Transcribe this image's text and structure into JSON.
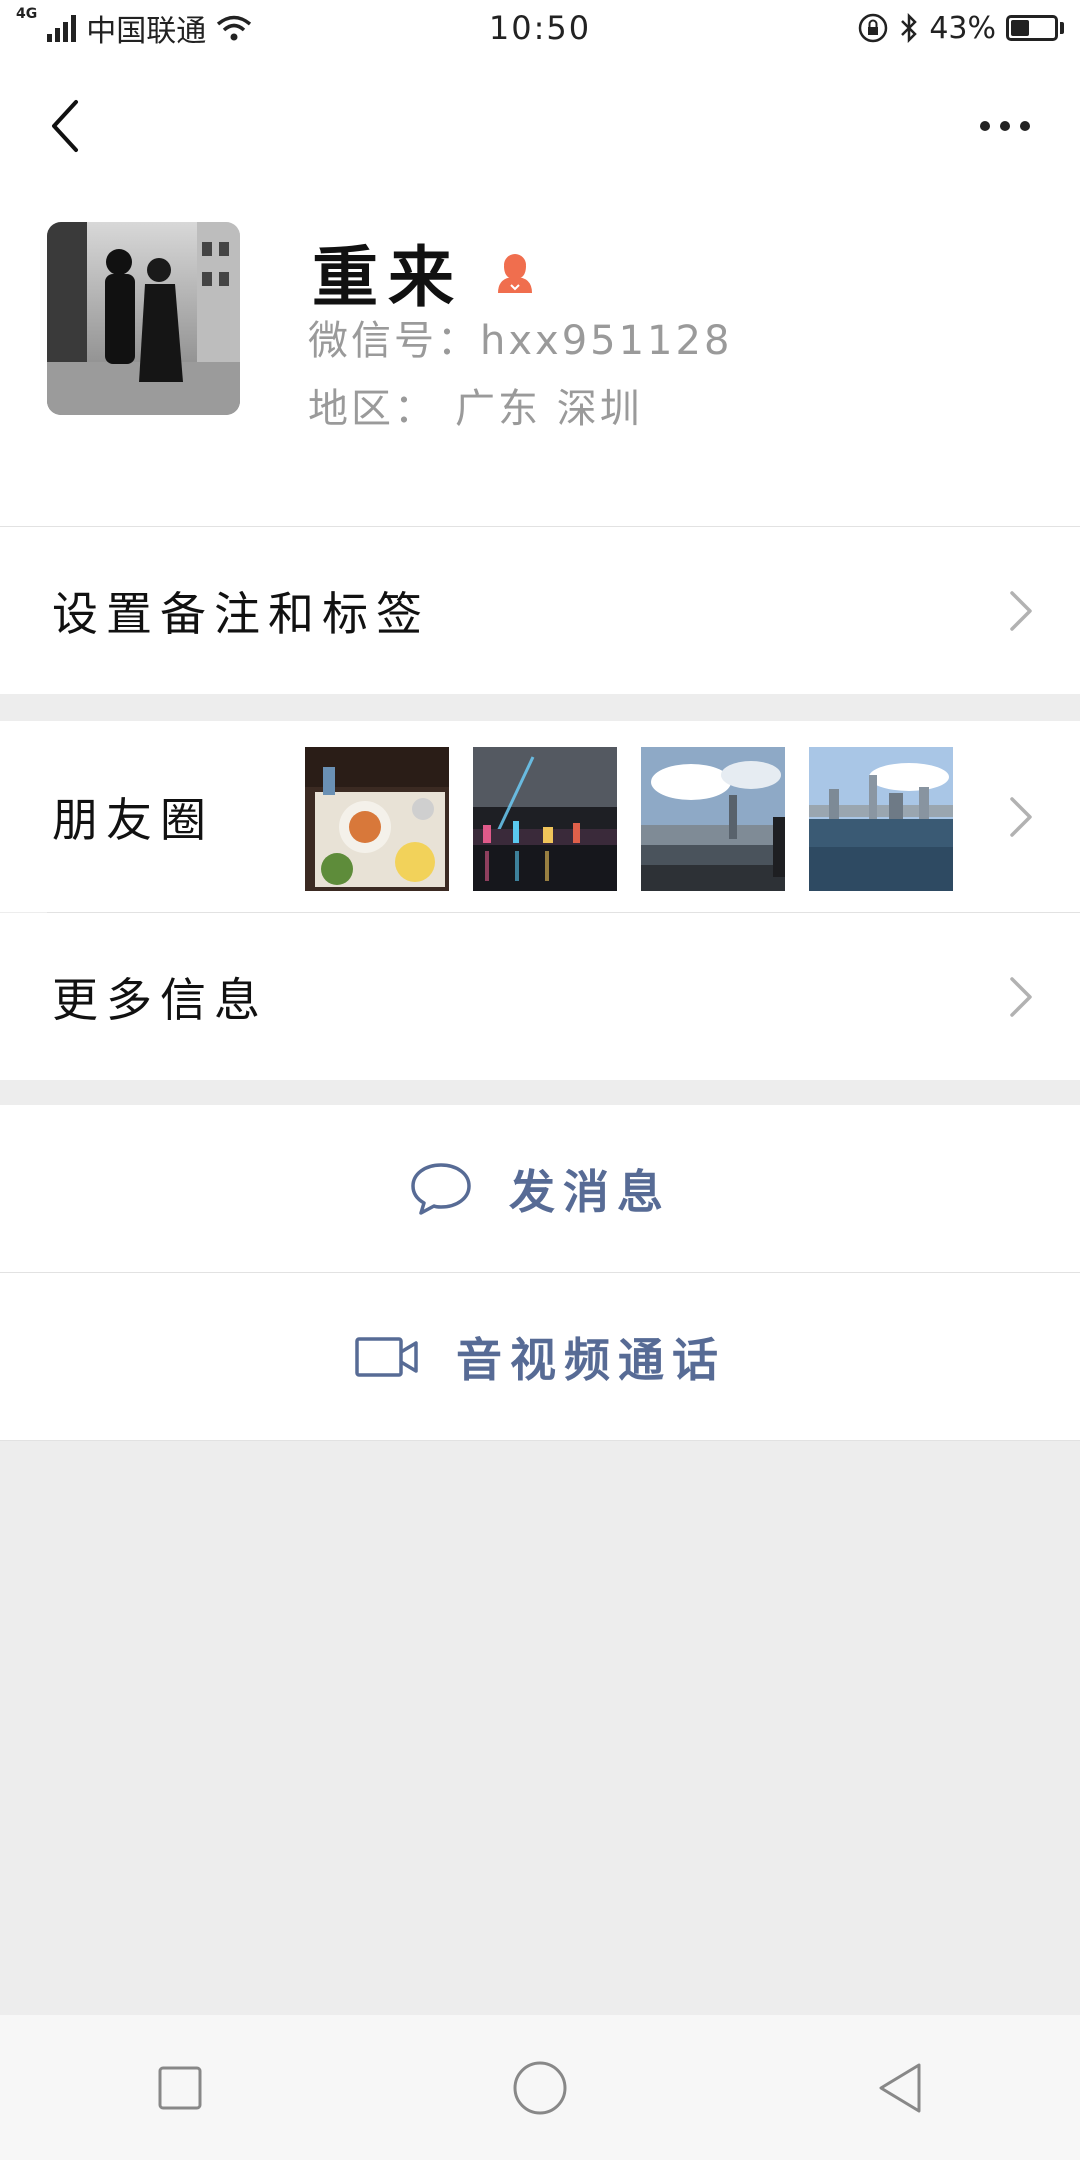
{
  "status_bar": {
    "network_type": "4G",
    "carrier": "中国联通",
    "time": "10:50",
    "battery_percent": "43%",
    "battery_level": 0.43,
    "icons": [
      "signal-icon",
      "wifi-icon",
      "rotation-lock-icon",
      "bluetooth-icon",
      "battery-icon"
    ]
  },
  "header": {
    "back_icon": "chevron-left-icon",
    "more_icon": "more-dots-icon"
  },
  "profile": {
    "name": "重来",
    "gender_icon": "female-icon",
    "wechat_id": "微信号：hxx951128",
    "region_label": "地区：",
    "region_value": "广东 深圳"
  },
  "menu": {
    "remarks_tags": "设置备注和标签",
    "moments": "朋友圈",
    "more_info": "更多信息"
  },
  "actions": {
    "send_message": "发消息",
    "video_call": "音视频通话"
  },
  "colors": {
    "accent_link": "#576b95",
    "female_icon": "#f06e4e",
    "secondary_text": "#9a9a9a",
    "page_background": "#ededed"
  }
}
